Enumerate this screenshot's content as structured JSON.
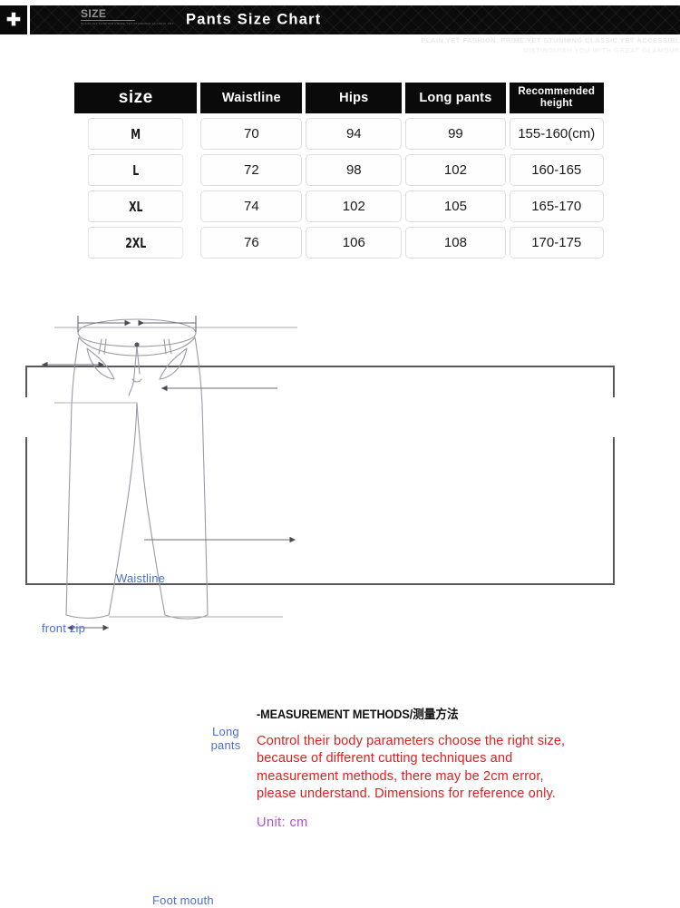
{
  "header": {
    "plus_icon": "plus-icon",
    "brand_mark": "SIZE",
    "brand_mark_sub": "PLAIN YET FASHION PRIME YET STUNNING CLASSIC YET",
    "title": "Pants Size Chart",
    "watermark_line1": "PLAIN YET FASHION. PRIME YET STUNNING CLASSIC YET ACCESSIBL",
    "watermark_line2": "DISTINGUISH YOU WITH GREAT GLAMOUR"
  },
  "table": {
    "columns": [
      "size",
      "Waistline",
      "Hips",
      "Long pants",
      "Recommended height"
    ],
    "rows": [
      {
        "size": "M",
        "waistline": "70",
        "hips": "94",
        "long_pants": "99",
        "height": "155-160(cm)"
      },
      {
        "size": "L",
        "waistline": "72",
        "hips": "98",
        "long_pants": "102",
        "height": "160-165"
      },
      {
        "size": "XL",
        "waistline": "74",
        "hips": "102",
        "long_pants": "105",
        "height": "165-170"
      },
      {
        "size": "2XL",
        "waistline": "76",
        "hips": "106",
        "long_pants": "108",
        "height": "170-175"
      }
    ]
  },
  "diagram": {
    "label_waistline": "Waistline",
    "label_front_zip": "front zip",
    "label_long_pants": "Long pants",
    "label_foot_mouth": "Foot mouth",
    "label_color": "#4a6fd0",
    "illustration": "pants-line-drawing"
  },
  "measurement": {
    "heading": "-MEASUREMENT METHODS/测量方法",
    "line1": "Control their body parameters choose the right size,",
    "line2": "because of different cutting techniques and",
    "line3": "measurement methods, there may be 2cm error,",
    "line4": "please understand. Dimensions for reference only.",
    "unit": "Unit: cm",
    "body_color": "#e02020",
    "unit_color": "#b24fd6"
  }
}
